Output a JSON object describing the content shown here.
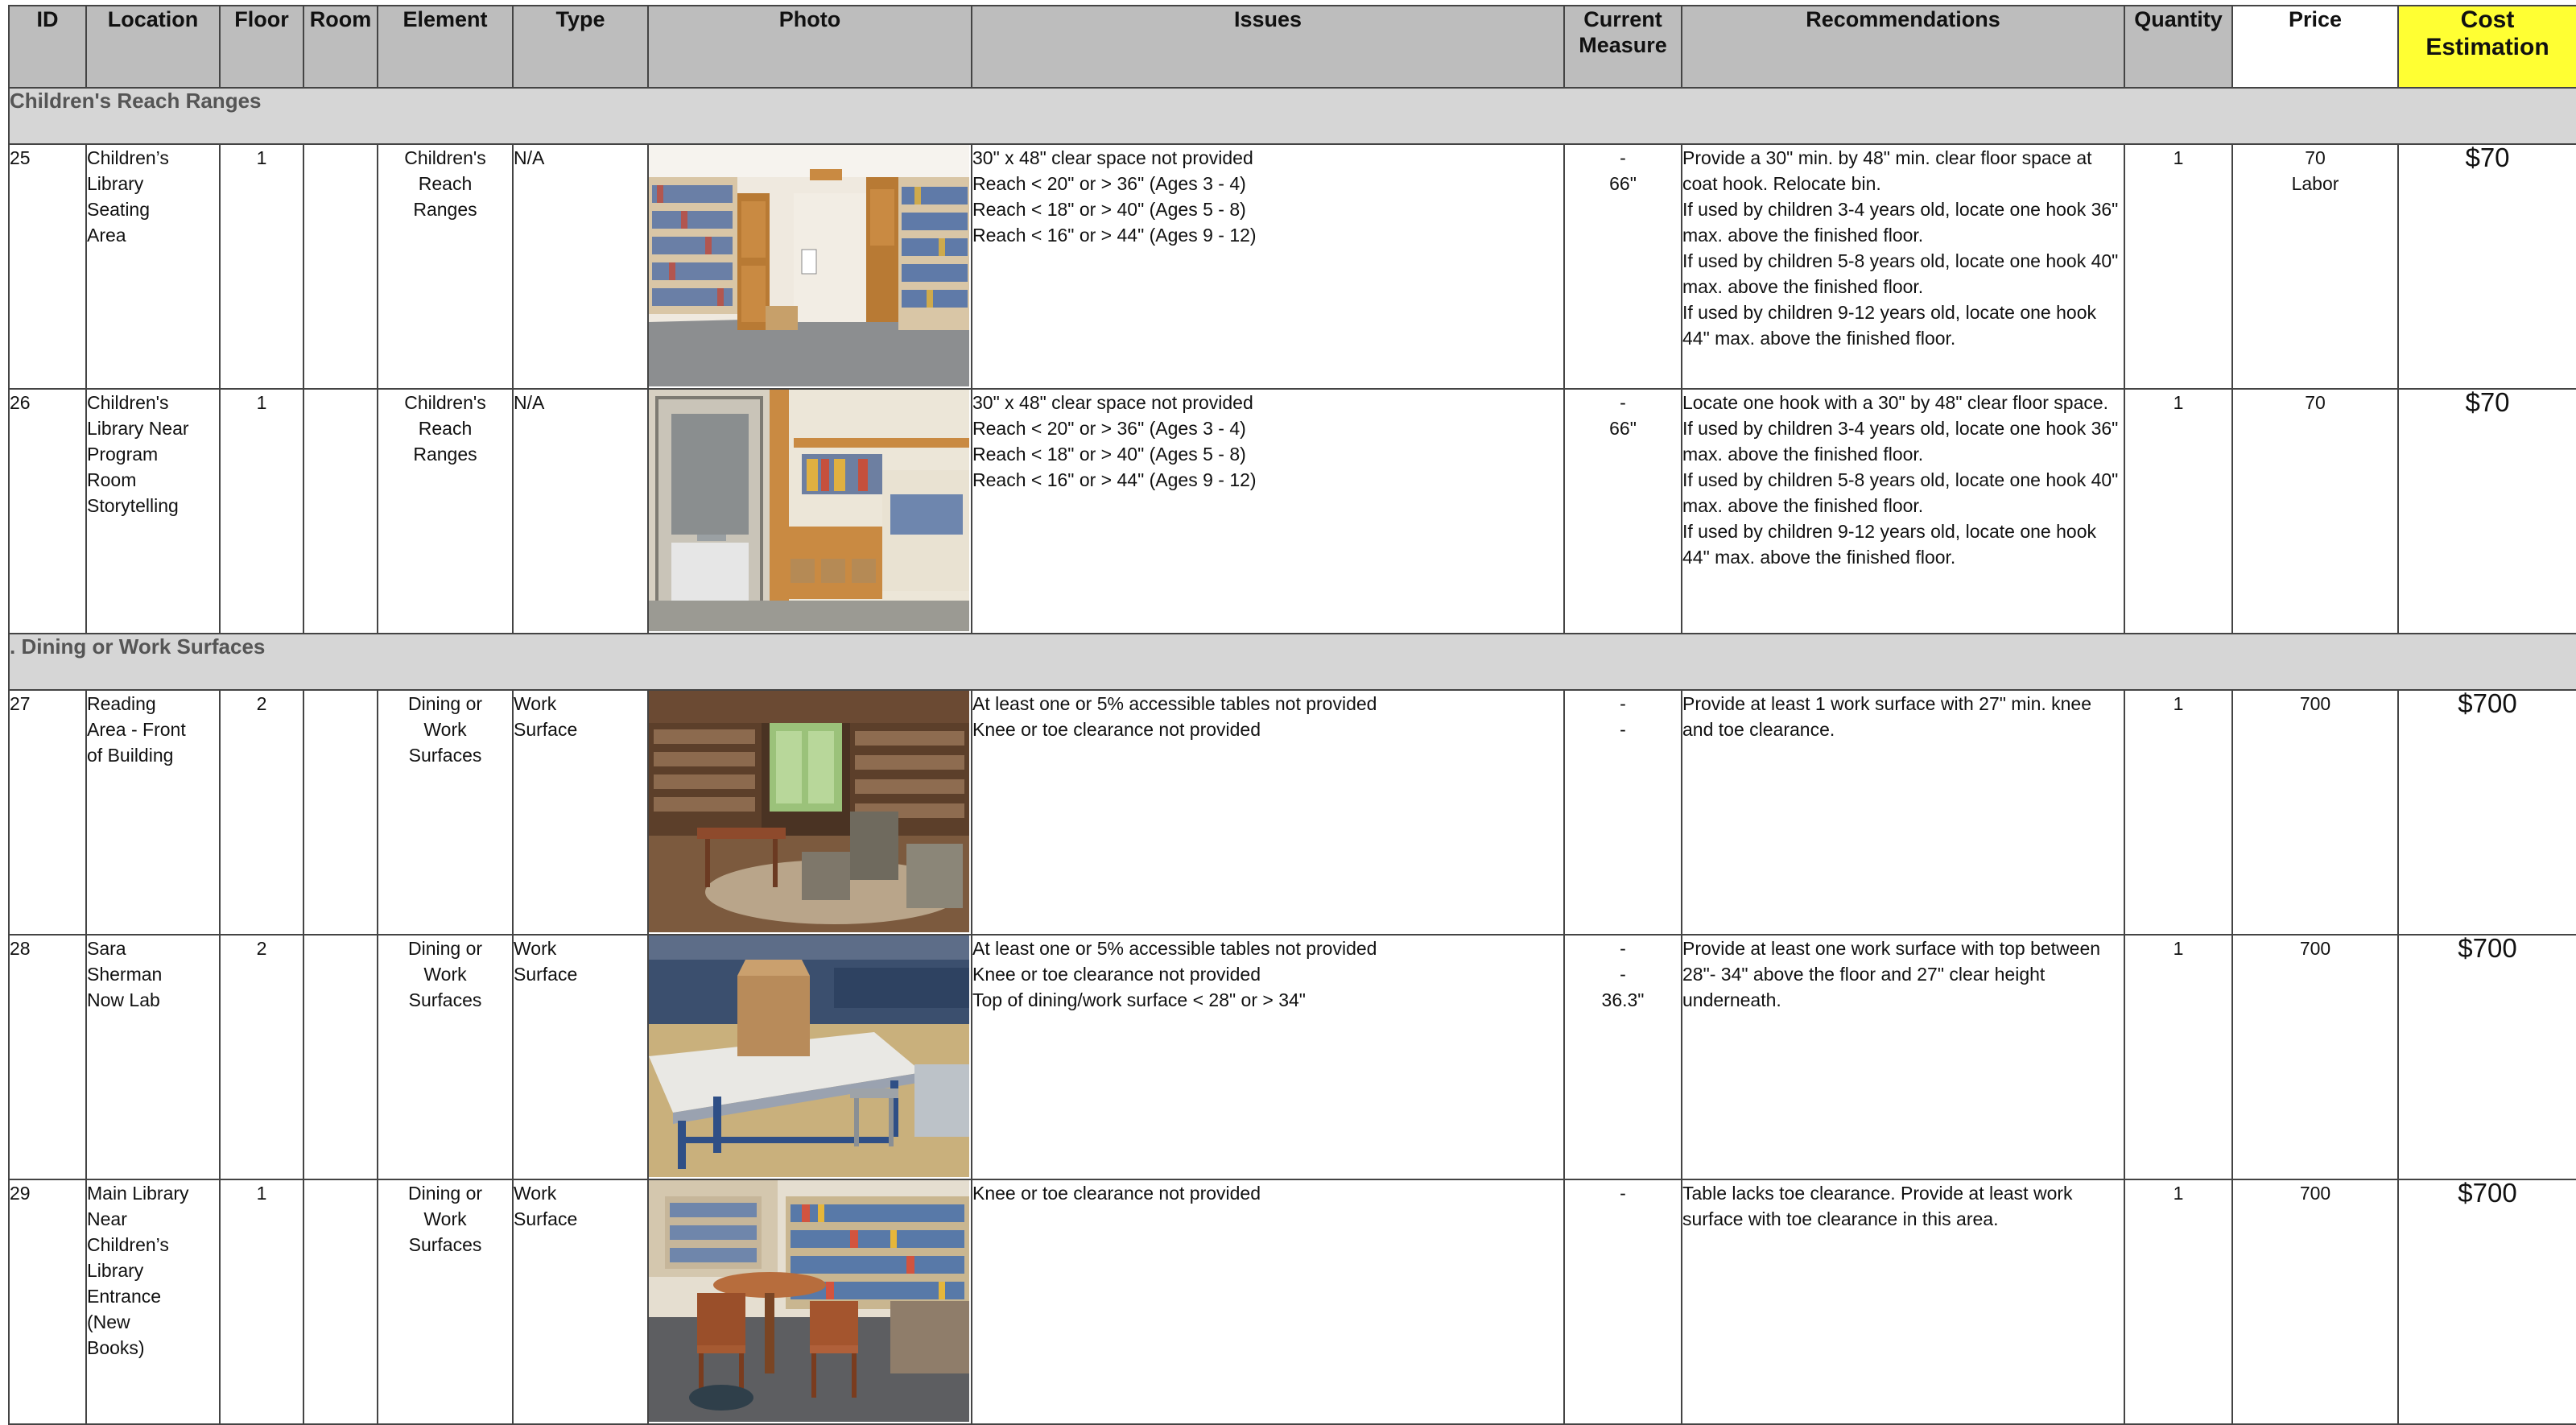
{
  "columns": [
    "ID",
    "Location",
    "Floor",
    "Room",
    "Element",
    "Type",
    "Photo",
    "Issues",
    "Current Measure",
    "Recommendations",
    "Quantity",
    "Price",
    "Cost Estimation"
  ],
  "sections": [
    {
      "title": "Children's Reach Ranges",
      "rows": [
        {
          "id": "25",
          "location": "Children’s Library Seating Area",
          "floor": "1",
          "room": "",
          "element": "Children's Reach Ranges",
          "type": "N/A",
          "photo_icon": "photo-shelves-corner",
          "issues": [
            "30\" x 48\" clear space not provided",
            "Reach < 20\" or > 36\" (Ages 3 - 4)",
            "Reach < 18\" or > 40\" (Ages 5 - 8)",
            "Reach < 16\" or > 44\" (Ages 9 - 12)"
          ],
          "measure": [
            "-",
            "66\""
          ],
          "recommendation": "Provide a 30\" min. by 48\" min. clear floor space at coat hook. Relocate bin.\nIf used by children 3-4 years old, locate one hook 36\" max. above the finished floor.\nIf used by children 5-8 years old, locate one hook 40\" max. above the finished floor.\nIf used by children 9-12 years old, locate one hook 44\" max. above the finished floor.",
          "quantity": "1",
          "price": [
            "70",
            "Labor"
          ],
          "cost": "$70"
        },
        {
          "id": "26",
          "location": "Children's Library Near Program Room Storytelling",
          "floor": "1",
          "room": "",
          "element": "Children's Reach Ranges",
          "type": "N/A",
          "photo_icon": "photo-door-shelves",
          "issues": [
            "30\" x 48\" clear space not provided",
            "Reach < 20\" or > 36\" (Ages 3 - 4)",
            "Reach < 18\" or > 40\" (Ages 5 - 8)",
            "Reach < 16\" or > 44\" (Ages 9 - 12)"
          ],
          "measure": [
            "-",
            "66\""
          ],
          "recommendation": "Locate one hook with a 30\" by 48\" clear floor space.\nIf used by children 3-4 years old, locate one hook 36\" max. above the finished floor.\nIf used by children 5-8 years old, locate one hook 40\" max. above the finished floor.\nIf used by children 9-12 years old, locate one hook 44\" max. above the finished floor.",
          "quantity": "1",
          "price": [
            "70"
          ],
          "cost": "$70"
        }
      ]
    },
    {
      "title": ". Dining or Work Surfaces",
      "rows": [
        {
          "id": "27",
          "location": "Reading Area - Front of Building",
          "floor": "2",
          "room": "",
          "element": "Dining or Work Surfaces",
          "type": "Work Surface",
          "photo_icon": "photo-reading-area",
          "issues": [
            "At least one or 5% accessible tables not provided",
            "Knee or toe clearance not provided"
          ],
          "measure": [
            "-",
            "-"
          ],
          "recommendation": "Provide at least 1 work surface with 27\" min. knee and toe clearance.",
          "quantity": "1",
          "price": [
            "700"
          ],
          "cost": "$700"
        },
        {
          "id": "28",
          "location": "Sara Sherman Now Lab",
          "floor": "2",
          "room": "",
          "element": "Dining or Work Surfaces",
          "type": "Work Surface",
          "photo_icon": "photo-lab-table",
          "issues": [
            "At least one or 5% accessible tables not provided",
            "Knee or toe clearance not provided",
            "Top of dining/work surface < 28\" or > 34\""
          ],
          "measure": [
            "-",
            "-",
            "36.3\""
          ],
          "recommendation": "Provide at least one work surface with top between 28\"- 34\" above the floor and 27\" clear height underneath.",
          "quantity": "1",
          "price": [
            "700"
          ],
          "cost": "$700"
        },
        {
          "id": "29",
          "location": "Main Library Near Children’s Library Entrance (New Books)",
          "floor": "1",
          "room": "",
          "element": "Dining or Work Surfaces",
          "type": "Work Surface",
          "photo_icon": "photo-round-table",
          "issues": [
            "Knee or toe clearance not provided"
          ],
          "measure": [
            "-"
          ],
          "recommendation": "Table lacks toe clearance. Provide at least work surface with toe clearance in this area.",
          "quantity": "1",
          "price": [
            "700"
          ],
          "cost": "$700"
        }
      ]
    }
  ]
}
